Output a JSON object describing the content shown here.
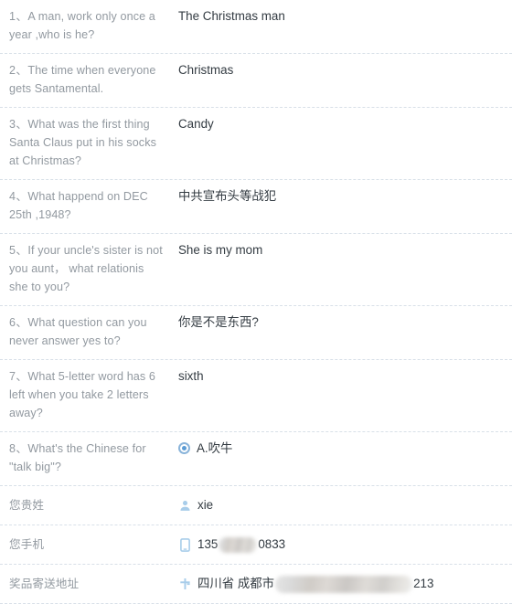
{
  "colors": {
    "question_text": "#9299a0",
    "answer_text": "#333b42",
    "divider": "#d8e0e8",
    "icon_blue": "#a8cdea",
    "radio_blue": "#5b9bd5",
    "background": "#ffffff"
  },
  "survey": {
    "rows": [
      {
        "number": "1、",
        "question": "A man, work only once a year ,who is he?",
        "answer": "The Christmas man",
        "type": "text"
      },
      {
        "number": "2、",
        "question": "The time when everyone gets Santamental.",
        "answer": "Christmas",
        "type": "text"
      },
      {
        "number": "3、",
        "question": "What was the first thing Santa Claus put in his socks at Christmas?",
        "answer": "Candy",
        "type": "text"
      },
      {
        "number": "4、",
        "question": "What happend on DEC 25th ,1948?",
        "answer": "中共宣布头等战犯",
        "type": "text"
      },
      {
        "number": "5、",
        "question": "If your uncle's sister is not you aunt， what relationis she to you?",
        "answer": "She is my mom",
        "type": "text"
      },
      {
        "number": "6、",
        "question": "What question can you never answer yes to?",
        "answer": "你是不是东西?",
        "type": "text"
      },
      {
        "number": "7、",
        "question": "What 5-letter word has 6 left when you take 2 letters away?",
        "answer": "sixth",
        "type": "text"
      },
      {
        "number": "8、",
        "question": "What's the Chinese for \"talk big\"?",
        "answer": "A.吹牛",
        "type": "radio",
        "radio_selected": true
      }
    ],
    "fields": [
      {
        "label": "您贵姓",
        "icon": "user-icon",
        "value": "xie",
        "redacted": false
      },
      {
        "label": "您手机",
        "icon": "mobile-phone-icon",
        "value_prefix": "135",
        "value_suffix": "0833",
        "redacted": true
      },
      {
        "label": "奖品寄送地址",
        "icon": "map-pin-icon",
        "value_prefix": "四川省 成都市",
        "value_suffix": "213",
        "redacted": true
      }
    ]
  }
}
